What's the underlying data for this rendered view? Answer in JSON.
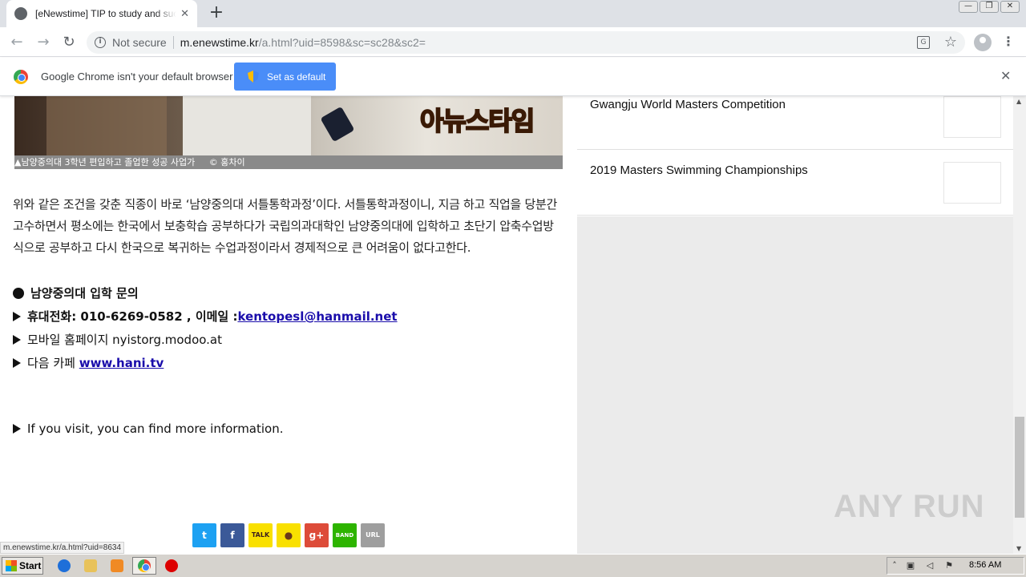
{
  "browser": {
    "tab_title": "[eNewstime] TIP to study and succeed",
    "tab_close": "✕",
    "new_tab": "+",
    "window_buttons": [
      "—",
      "❐",
      "✕"
    ],
    "back": "←",
    "forward": "→",
    "reload": "↻",
    "security_label": "Not secure",
    "url_host": "m.enewstime.kr",
    "url_path": "/a.html?uid=8598&sc=sc28&sc2=",
    "star": "☆",
    "menu": "⋮"
  },
  "infobar": {
    "message": "Google Chrome isn't your default browser",
    "button": "Set as default",
    "close": "✕"
  },
  "article": {
    "photo_watermark": "아뉴스타임",
    "caption": "▲남양중의대 3학년 편입하고 졸업한 성공 사업가     © 홍차이",
    "paragraph": "위와 같은 조건을 갖춘 직종이 바로 ‘남양중의대 서틀통학과정’이다. 서틀통학과정이니, 지금 하고 직업을 당분간 고수하면서 평소에는 한국에서 보충학습 공부하다가 국립의과대학인 남양중의대에 입학하고 초단기 압축수업방식으로 공부하고 다시 한국으로 복귀하는 수업과정이라서 경제적으로 큰 어려움이 없다고한다.",
    "inquiry_title": "남양중의대 입학 문의",
    "phone_label": "휴대전화: 010-6269-0582 , 이메일 :",
    "email": "kentopesl@hanmail.net",
    "homepage_label": "모바일 홈페이지 nyistorg.modoo.at",
    "cafe_label": "다음 카페 ",
    "cafe_link": "www.hani.tv",
    "visit_text": "If you visit, you can find more information."
  },
  "social": [
    {
      "name": "twitter",
      "glyph": "t",
      "color": "#1da1f2"
    },
    {
      "name": "facebook",
      "glyph": "f",
      "color": "#3b5998"
    },
    {
      "name": "kakaotalk",
      "glyph": "TALK",
      "color": "#f9e000"
    },
    {
      "name": "kakaostory",
      "glyph": "●",
      "color": "#f9e000"
    },
    {
      "name": "googleplus",
      "glyph": "g+",
      "color": "#dd4b39"
    },
    {
      "name": "band",
      "glyph": "BAND",
      "color": "#2db400"
    },
    {
      "name": "url-copy",
      "glyph": "URL",
      "color": "#9e9e9e"
    }
  ],
  "sidebar": {
    "news": [
      {
        "title": "Gwangju World Masters Competition"
      },
      {
        "title": "2019 Masters Swimming Championships"
      }
    ]
  },
  "watermark": "ANY RUN",
  "status_url": "m.enewstime.kr/a.html?uid=8634",
  "taskbar": {
    "start": "Start",
    "clock": "8:56 AM"
  }
}
